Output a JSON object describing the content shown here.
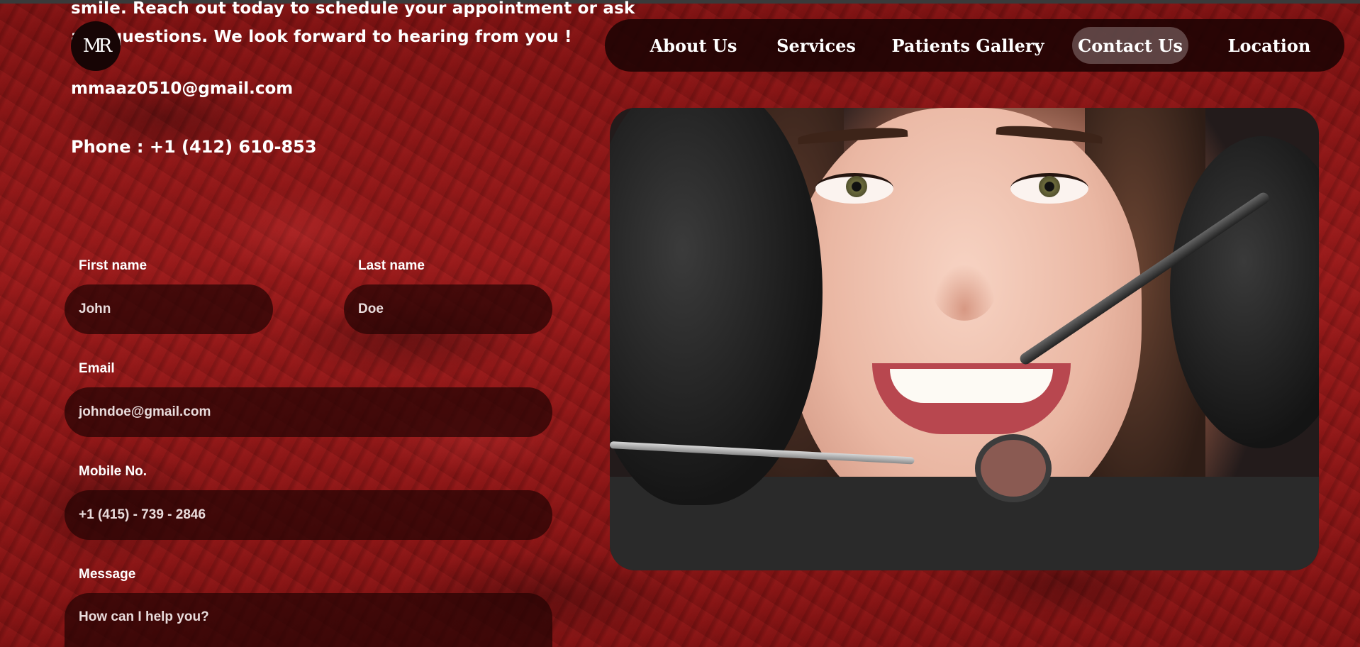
{
  "intro": {
    "line1": "smile. Reach out today to schedule your appointment or ask",
    "line2": "any questions. We look forward to hearing from you !"
  },
  "logo": {
    "text": "MR"
  },
  "contact": {
    "email": "mmaaz0510@gmail.com",
    "phone": "Phone : +1 (412) 610-853"
  },
  "nav": {
    "items": [
      {
        "label": "About Us"
      },
      {
        "label": "Services"
      },
      {
        "label": "Patients Gallery"
      },
      {
        "label": "Contact Us",
        "active": true
      },
      {
        "label": "Location"
      }
    ]
  },
  "form": {
    "first_name": {
      "label": "First name",
      "placeholder": "John"
    },
    "last_name": {
      "label": "Last name",
      "placeholder": "Doe"
    },
    "email": {
      "label": "Email",
      "placeholder": "johndoe@gmail.com"
    },
    "mobile": {
      "label": "Mobile No.",
      "placeholder": "+1 (415) - 739 - 2846"
    },
    "message": {
      "label": "Message",
      "placeholder": "How can I help you?"
    }
  },
  "colors": {
    "background": "#8e1515",
    "panel": "#1c0303",
    "nav_active": "#5a3a3a",
    "text": "#ffffff"
  },
  "icons": {
    "logo": "monogram-logo-icon"
  }
}
